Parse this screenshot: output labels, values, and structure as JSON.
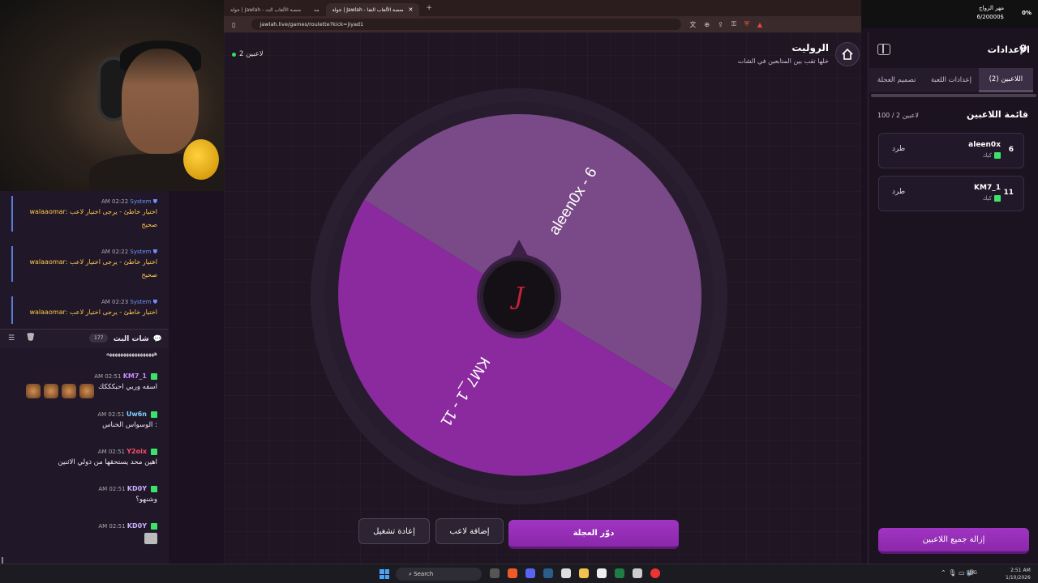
{
  "browser": {
    "tabs": [
      {
        "label": "جولة | Jawlah - منصة الألعاب التفا"
      },
      {
        "label": "مه"
      },
      {
        "label": "جولة | Jawlah - منصة الألعاب الت"
      }
    ],
    "url": "jawlah.live/games/roulette?kick=jiyad1"
  },
  "tray_widget": {
    "line1": "مهر الزواج",
    "line2": "6/20000$",
    "percent": "0%"
  },
  "chat": {
    "system_messages": [
      {
        "time": "AM 02:22",
        "sender": "System",
        "text": "walaaomar: اختيار خاطئ - يرجى اختيار لاعب صحيح"
      },
      {
        "time": "AM 02:22",
        "sender": "System",
        "text": "walaaomar: اختيار خاطئ - يرجى اختيار لاعب صحيح"
      },
      {
        "time": "AM 02:23",
        "sender": "System",
        "text": "walaaomar: اختيار خاطئ - يرجى اختيار لاعب"
      }
    ],
    "header_title": "شات البث",
    "viewer_count": "177",
    "top_text": "هههههههههههههههههه",
    "messages": [
      {
        "time": "AM 02:51",
        "user": "KM7_1",
        "color": "#c98bff",
        "text": "اسفه وربي احبكككك"
      },
      {
        "time": "AM 02:51",
        "user": "Uw6n",
        "color": "#7fd1ff",
        "text": "الوسواس الخناس :"
      },
      {
        "time": "AM 02:51",
        "user": "Y2oix",
        "color": "#ff4d6d",
        "text": "اهين محد يستحقها من ذولي الاثنين"
      },
      {
        "time": "AM 02:51",
        "user": "KD0Y",
        "color": "#c9b3ff",
        "text": "وشنهو؟"
      },
      {
        "time": "AM 02:51",
        "user": "KD0Y",
        "color": "#c9b3ff",
        "text": ""
      }
    ]
  },
  "game": {
    "players_online": "2 لاعبين",
    "title": "الروليت",
    "subtitle": "خلها تقب بين المتابعين في الشات",
    "wheel": {
      "segments": [
        {
          "label": "aleen0x - 6",
          "color": "#7a4a88"
        },
        {
          "label": "KM7_1 - 11",
          "color": "#8a2a9e"
        }
      ]
    },
    "buttons": {
      "restart": "إعادة تشغيل",
      "add_player": "إضافة لاعب",
      "spin": "دوّر العجلة"
    }
  },
  "settings": {
    "title": "الإعدادات",
    "tabs": [
      "اللاعبين (2)",
      "إعدادات اللعبة",
      "تصميم العجلة"
    ],
    "active_tab": 0,
    "list_title": "قائمة اللاعبين",
    "list_count": "100 / 2 لاعبين",
    "players": [
      {
        "number": "6",
        "name": "aleen0x",
        "platform": "كيك",
        "kick_label": "طرد"
      },
      {
        "number": "11",
        "name": "KM7_1",
        "platform": "كيك",
        "kick_label": "طرد"
      }
    ],
    "remove_all": "إزالة جميع اللاعبين"
  },
  "taskbar": {
    "search": "Search",
    "lang": "ENG",
    "time": "2:51 AM",
    "date": "1/10/2026"
  }
}
